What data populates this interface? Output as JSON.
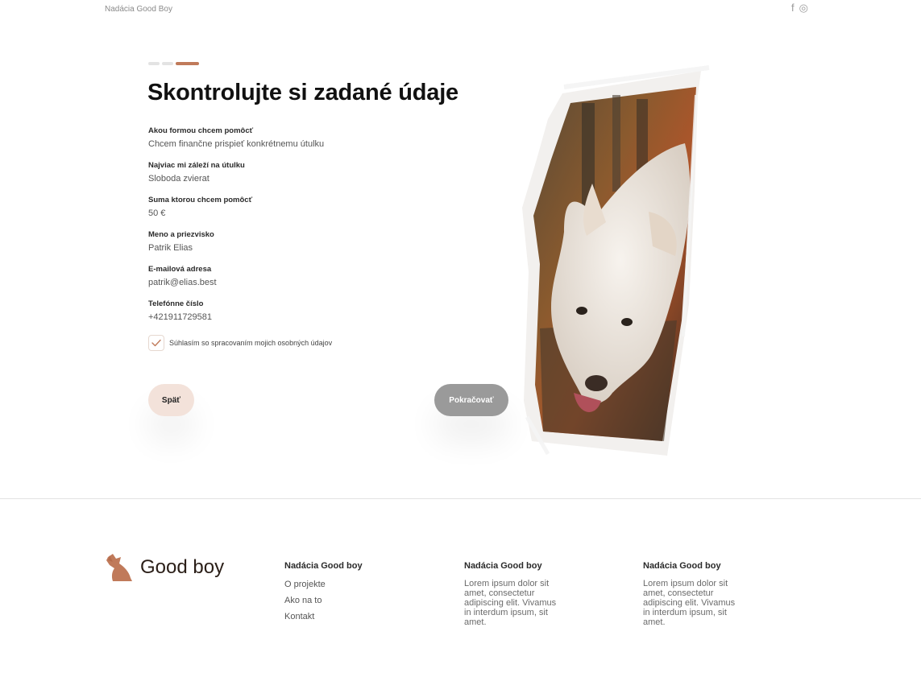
{
  "header": {
    "brand": "Nadácia Good Boy",
    "social": [
      {
        "icon": "facebook-icon",
        "glyph": "f"
      },
      {
        "icon": "instagram-icon",
        "glyph": "◎"
      }
    ]
  },
  "steps": {
    "total": 3,
    "current": 3
  },
  "form": {
    "title": "Skontrolujte si zadané údaje",
    "fields": [
      {
        "label": "Akou formou chcem pomôcť",
        "value": "Chcem finančne prispieť konkrétnemu útulku"
      },
      {
        "label": "Najviac mi záleží na útulku",
        "value": "Sloboda zvierat"
      },
      {
        "label": "Suma ktorou chcem pomôcť",
        "value": "50 €"
      },
      {
        "label": "Meno a priezvisko",
        "value": "Patrik Elias"
      },
      {
        "label": "E-mailová adresa",
        "value": "patrik@elias.best"
      },
      {
        "label": "Telefónne číslo",
        "value": "+421911729581"
      }
    ],
    "consent": {
      "label": "Súhlasím so spracovaním mojich osobných údajov",
      "checked": true
    },
    "back_label": "Späť",
    "continue_label": "Pokračovať"
  },
  "footer": {
    "logo_text": "Good boy",
    "columns": [
      {
        "title": "Nadácia Good boy",
        "links": [
          "O projekte",
          "Ako na to",
          "Kontakt"
        ]
      },
      {
        "title": "Nadácia Good boy",
        "text": "Lorem ipsum dolor sit amet, consectetur adipiscing elit. Vivamus in interdum ipsum, sit amet."
      },
      {
        "title": "Nadácia Good boy",
        "text": "Lorem ipsum dolor sit amet, consectetur adipiscing elit. Vivamus in interdum ipsum, sit amet."
      }
    ]
  },
  "colors": {
    "accent": "#c07a5a",
    "button_back": "#f3e2da",
    "button_continue": "#9a9a9a"
  }
}
